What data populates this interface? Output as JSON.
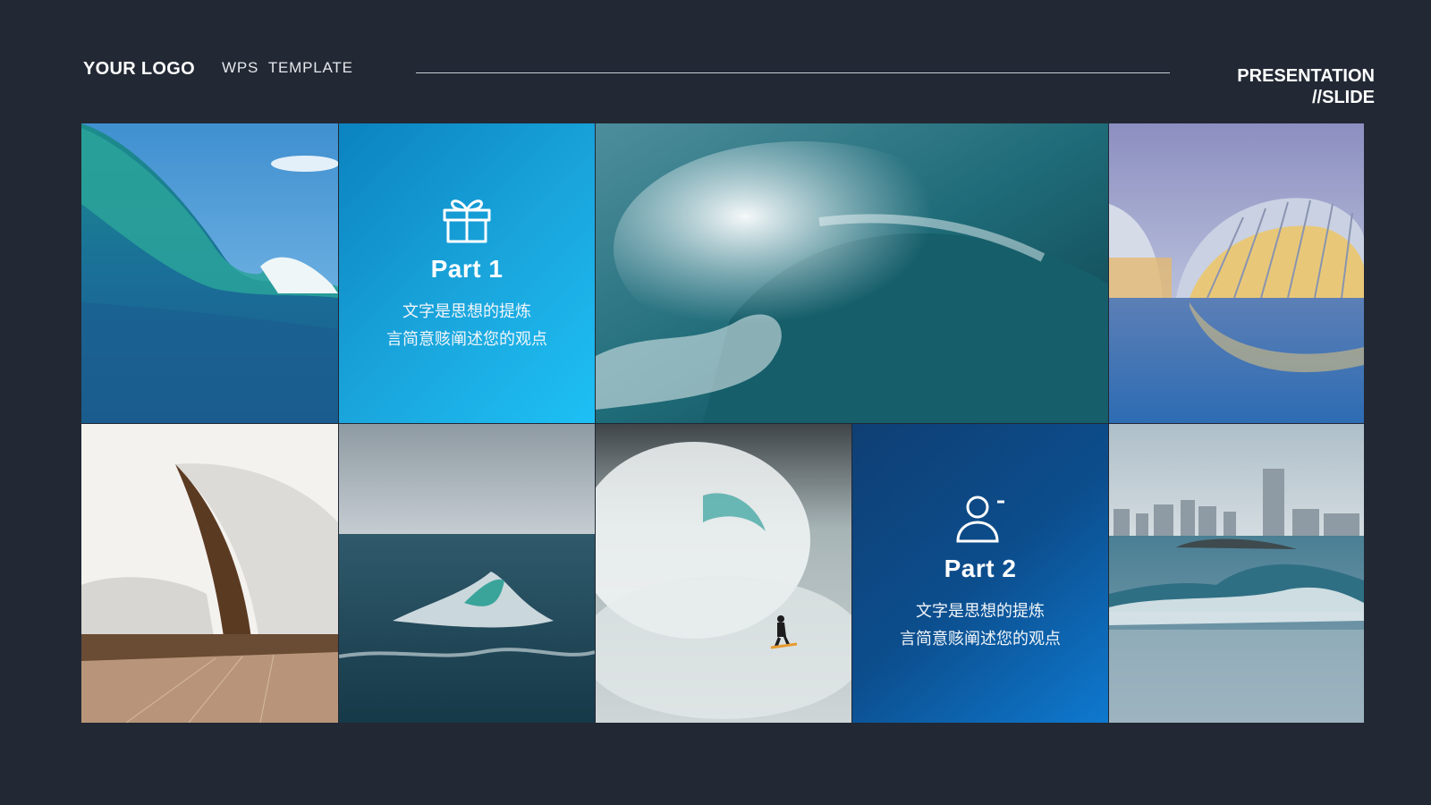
{
  "header": {
    "logo": "YOUR LOGO",
    "subtitle": "WPS  TEMPLATE",
    "presentation_line1": "PRESENTATION",
    "presentation_line2": "//SLIDE"
  },
  "panels": [
    {
      "icon": "gift-icon",
      "title": "Part 1",
      "line1": "文字是思想的提炼",
      "line2": "言简意赅阐述您的观点",
      "color": "#1aa6dd"
    },
    {
      "icon": "user-icon",
      "title": "Part 2",
      "line1": "文字是思想的提炼",
      "line2": "言简意赅阐述您的观点",
      "color": "#0c4d8c"
    }
  ],
  "colors": {
    "background": "#222834",
    "accent_light": "#1aa6dd",
    "accent_dark": "#0c4d8c"
  }
}
